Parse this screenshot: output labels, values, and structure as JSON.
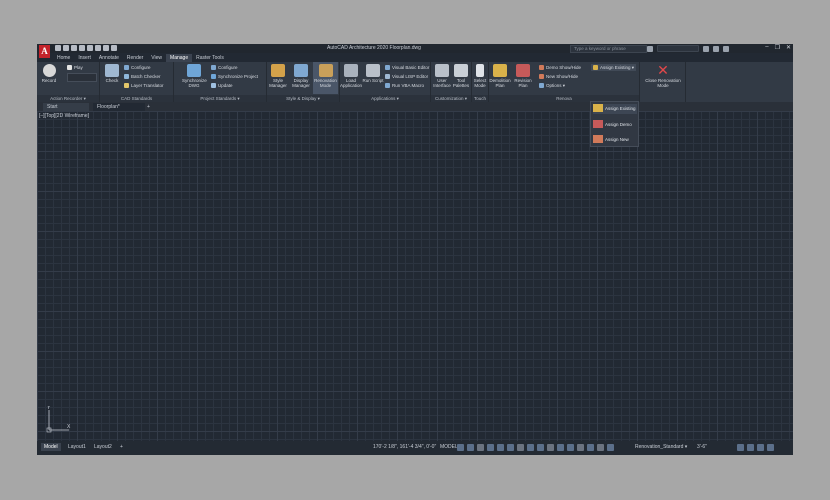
{
  "titlebar": {
    "title": "AutoCAD Architecture 2020   Floorplan.dwg",
    "search_placeholder": "Type a keyword or phrase",
    "logo": "A"
  },
  "ribbon_tabs": [
    "Home",
    "Insert",
    "Annotate",
    "Render",
    "View",
    "Manage",
    "Raster Tools"
  ],
  "active_tab": "Manage",
  "panels": {
    "action_recorder": {
      "title": "Action Recorder ▾",
      "record": "Record",
      "play": "Play"
    },
    "cad_standards": {
      "title": "CAD Standards",
      "check": "Check",
      "configure": "Configure",
      "batch_checker": "Batch Checker",
      "layer_translator": "Layer Translator"
    },
    "project_standards": {
      "title": "Project Standards ▾",
      "synchronize_dwg": "Synchronize DWG",
      "configure": "Configure",
      "synchronize_project": "Synchronize Project",
      "update": "Update"
    },
    "style_display": {
      "title": "Style & Display ▾",
      "style_manager": "Style Manager",
      "display_manager": "Display Manager",
      "renovation_mode": "Renovation Mode"
    },
    "applications": {
      "title": "Applications ▾",
      "load_application": "Load Application",
      "run_script": "Run Script",
      "visual_basic_editor": "Visual Basic Editor",
      "visual_lisp_editor": "Visual LISP Editor",
      "run_vba_macro": "Run VBA Macro"
    },
    "customization": {
      "title": "Customization ▾",
      "user_interface": "User Interface",
      "tool_palettes": "Tool Palettes"
    },
    "touch": {
      "title": "Touch",
      "select_mode": "Select Mode"
    },
    "renovation": {
      "title": "Renova",
      "demolition_plan": "Demolition Plan",
      "revision_plan": "Revision Plan",
      "demo_show_hide": "Demo Show/Hide",
      "new_show_hide": "New Show/Hide",
      "options": "Options ▾",
      "assign_existing": "Assign Existing ▾",
      "close_renovation_mode": "Close Renovation Mode"
    }
  },
  "dropdown": {
    "items": [
      "Assign Existing",
      "Assign Demo",
      "Assign New"
    ]
  },
  "doc_tabs": {
    "start": "Start",
    "active": "Floorplan*",
    "plus": "+"
  },
  "viewport_label": "[–][Top][2D Wireframe]",
  "ucs": {
    "x": "X",
    "y": "Y"
  },
  "status": {
    "layout_tabs": [
      "Model",
      "Layout1",
      "Layout2",
      "+"
    ],
    "coords": "170'-2 1/8\", 161'-4 3/4\", 0'-0\"",
    "model": "MODEL",
    "display_config": "Renovation_Standard ▾",
    "scale": "3'-6\""
  }
}
